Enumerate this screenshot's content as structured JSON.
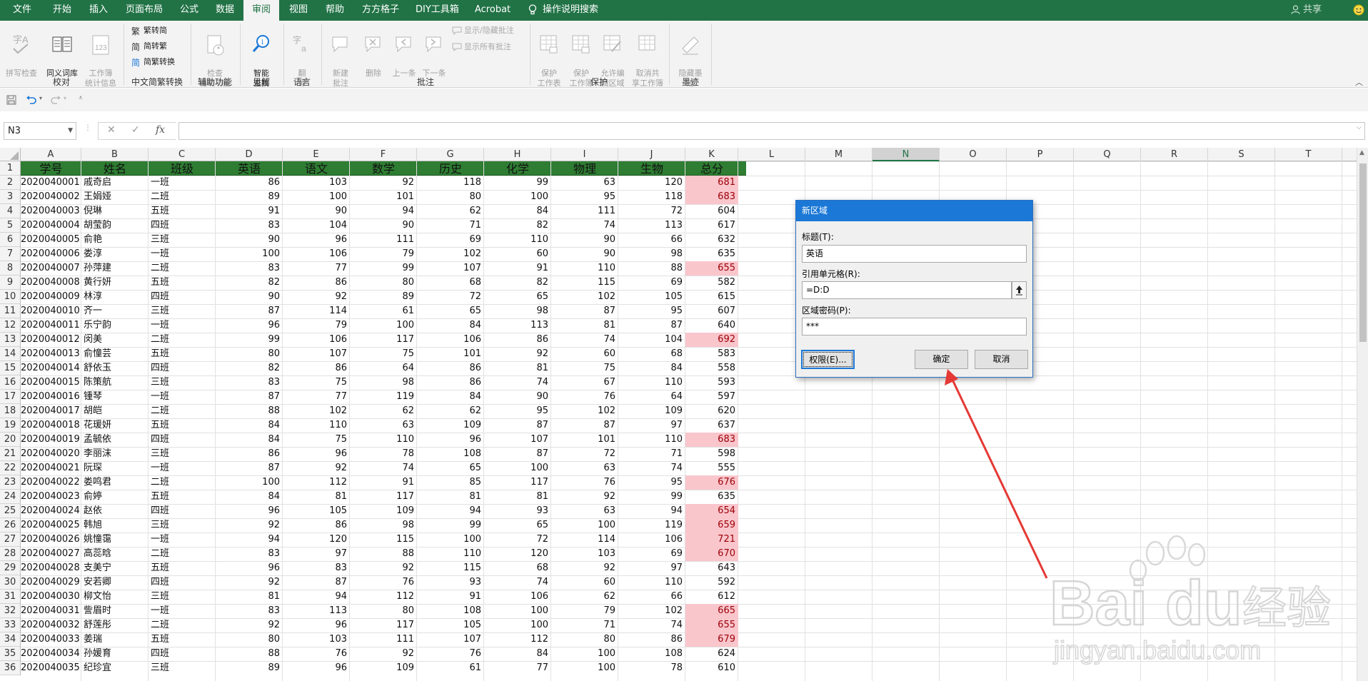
{
  "tabs": [
    {
      "label": "文件",
      "active": false
    },
    {
      "label": "开始",
      "active": false
    },
    {
      "label": "插入",
      "active": false
    },
    {
      "label": "页面布局",
      "active": false
    },
    {
      "label": "公式",
      "active": false
    },
    {
      "label": "数据",
      "active": false
    },
    {
      "label": "审阅",
      "active": true
    },
    {
      "label": "视图",
      "active": false
    },
    {
      "label": "帮助",
      "active": false
    },
    {
      "label": "方方格子",
      "active": false
    },
    {
      "label": "DIY工具箱",
      "active": false
    },
    {
      "label": "Acrobat",
      "active": false
    }
  ],
  "tell_me": "操作说明搜索",
  "share": "共享",
  "ribbon": {
    "groups": [
      "校对",
      "中文简繁转换",
      "辅助功能",
      "见解",
      "语言",
      "批注",
      "保护",
      "墨迹"
    ],
    "spell": "拼写检查",
    "thesaurus": "同义词库",
    "wb_stats": "工作簿\n统计信息",
    "trad_to_simp": "繁转简",
    "simp_to_trad": "简转繁",
    "conv": "简繁转换",
    "check_access": "检查\n辅助功能",
    "smart_lookup": "智能\n查找",
    "translate": "翻\n译",
    "new_comment": "新建\n批注",
    "delete": "删除",
    "prev": "上一条",
    "next": "下一条",
    "show_hide": "显示/隐藏批注",
    "show_all": "显示所有批注",
    "protect_sheet": "保护\n工作表",
    "protect_wb": "保护\n工作簿",
    "allow_edit": "允许编\n辑区域",
    "unshare": "取消共\n享工作簿",
    "hide_ink": "隐藏墨\n迹"
  },
  "namebox": "N3",
  "formula_value": "",
  "columns": [
    "A",
    "B",
    "C",
    "D",
    "E",
    "F",
    "G",
    "H",
    "I",
    "J",
    "K",
    "L",
    "M",
    "N",
    "O",
    "P",
    "Q",
    "R",
    "S",
    "T"
  ],
  "selected_col": "N",
  "headers": [
    "学号",
    "姓名",
    "班级",
    "英语",
    "语文",
    "数学",
    "历史",
    "化学",
    "物理",
    "生物",
    "总分"
  ],
  "rows": [
    [
      "2020040001",
      "戚奇启",
      "一班",
      "86",
      "103",
      "92",
      "118",
      "99",
      "63",
      "120",
      "681"
    ],
    [
      "2020040002",
      "王娟娅",
      "二班",
      "89",
      "100",
      "101",
      "80",
      "100",
      "95",
      "118",
      "683"
    ],
    [
      "2020040003",
      "倪琳",
      "五班",
      "91",
      "90",
      "94",
      "62",
      "84",
      "111",
      "72",
      "604"
    ],
    [
      "2020040004",
      "胡莹韵",
      "四班",
      "83",
      "104",
      "90",
      "71",
      "82",
      "74",
      "113",
      "617"
    ],
    [
      "2020040005",
      "俞艳",
      "三班",
      "90",
      "96",
      "111",
      "69",
      "110",
      "90",
      "66",
      "632"
    ],
    [
      "2020040006",
      "娄淳",
      "一班",
      "100",
      "106",
      "79",
      "102",
      "60",
      "90",
      "98",
      "635"
    ],
    [
      "2020040007",
      "孙萍建",
      "二班",
      "83",
      "77",
      "99",
      "107",
      "91",
      "110",
      "88",
      "655"
    ],
    [
      "2020040008",
      "黄行妍",
      "五班",
      "82",
      "86",
      "80",
      "68",
      "82",
      "115",
      "69",
      "582"
    ],
    [
      "2020040009",
      "林淳",
      "四班",
      "90",
      "92",
      "89",
      "72",
      "65",
      "102",
      "105",
      "615"
    ],
    [
      "2020040010",
      "齐一",
      "三班",
      "87",
      "114",
      "61",
      "65",
      "98",
      "87",
      "95",
      "607"
    ],
    [
      "2020040011",
      "乐宁韵",
      "一班",
      "96",
      "79",
      "100",
      "84",
      "113",
      "81",
      "87",
      "640"
    ],
    [
      "2020040012",
      "闵美",
      "二班",
      "99",
      "106",
      "117",
      "106",
      "86",
      "74",
      "104",
      "692"
    ],
    [
      "2020040013",
      "俞憧芸",
      "五班",
      "80",
      "107",
      "75",
      "101",
      "92",
      "60",
      "68",
      "583"
    ],
    [
      "2020040014",
      "舒依玉",
      "四班",
      "82",
      "86",
      "64",
      "86",
      "81",
      "75",
      "84",
      "558"
    ],
    [
      "2020040015",
      "陈策航",
      "三班",
      "83",
      "75",
      "98",
      "86",
      "74",
      "67",
      "110",
      "593"
    ],
    [
      "2020040016",
      "锺琴",
      "一班",
      "87",
      "77",
      "119",
      "84",
      "90",
      "76",
      "64",
      "597"
    ],
    [
      "2020040017",
      "胡皑",
      "二班",
      "88",
      "102",
      "62",
      "62",
      "95",
      "102",
      "109",
      "620"
    ],
    [
      "2020040018",
      "花瑗妍",
      "五班",
      "84",
      "110",
      "63",
      "109",
      "87",
      "87",
      "97",
      "637"
    ],
    [
      "2020040019",
      "孟毓依",
      "四班",
      "84",
      "75",
      "110",
      "96",
      "107",
      "101",
      "110",
      "683"
    ],
    [
      "2020040020",
      "李丽沫",
      "三班",
      "86",
      "96",
      "78",
      "108",
      "87",
      "72",
      "71",
      "598"
    ],
    [
      "2020040021",
      "阮琛",
      "一班",
      "87",
      "92",
      "74",
      "65",
      "100",
      "63",
      "74",
      "555"
    ],
    [
      "2020040022",
      "娄鸣君",
      "二班",
      "100",
      "112",
      "91",
      "85",
      "117",
      "76",
      "95",
      "676"
    ],
    [
      "2020040023",
      "俞婷",
      "五班",
      "84",
      "81",
      "117",
      "81",
      "81",
      "92",
      "99",
      "635"
    ],
    [
      "2020040024",
      "赵依",
      "四班",
      "96",
      "105",
      "109",
      "94",
      "93",
      "63",
      "94",
      "654"
    ],
    [
      "2020040025",
      "韩旭",
      "三班",
      "92",
      "86",
      "98",
      "99",
      "65",
      "100",
      "119",
      "659"
    ],
    [
      "2020040026",
      "姚憧霭",
      "一班",
      "94",
      "120",
      "115",
      "100",
      "72",
      "114",
      "106",
      "721"
    ],
    [
      "2020040027",
      "高蕊晗",
      "二班",
      "83",
      "97",
      "88",
      "110",
      "120",
      "103",
      "69",
      "670"
    ],
    [
      "2020040028",
      "支美宁",
      "五班",
      "96",
      "83",
      "92",
      "115",
      "68",
      "92",
      "97",
      "643"
    ],
    [
      "2020040029",
      "安若卿",
      "四班",
      "92",
      "87",
      "76",
      "93",
      "74",
      "60",
      "110",
      "592"
    ],
    [
      "2020040030",
      "柳文怡",
      "三班",
      "81",
      "94",
      "112",
      "91",
      "106",
      "62",
      "66",
      "612"
    ],
    [
      "2020040031",
      "訾眉时",
      "一班",
      "83",
      "113",
      "80",
      "108",
      "100",
      "79",
      "102",
      "665"
    ],
    [
      "2020040032",
      "舒莲彤",
      "二班",
      "92",
      "96",
      "117",
      "105",
      "100",
      "71",
      "74",
      "655"
    ],
    [
      "2020040033",
      "姜瑞",
      "五班",
      "80",
      "103",
      "111",
      "107",
      "112",
      "80",
      "86",
      "679"
    ],
    [
      "2020040034",
      "孙媛育",
      "四班",
      "88",
      "76",
      "92",
      "76",
      "84",
      "100",
      "108",
      "624"
    ],
    [
      "2020040035",
      "纪珍宜",
      "三班",
      "89",
      "96",
      "109",
      "61",
      "77",
      "100",
      "78",
      "610"
    ]
  ],
  "highlight_threshold": 650,
  "colors": {
    "excel_green": "#217346",
    "header_fill": "#2e7d32",
    "highlight_fill": "#f9c6cc",
    "highlight_text": "#9c0006",
    "dialog_title": "#1b78d6",
    "arrow": "#e53935"
  },
  "dialog": {
    "title": "新区域",
    "title_label": "标题(T):",
    "title_value": "英语",
    "ref_label": "引用单元格(R):",
    "ref_value": "=D:D",
    "pwd_label": "区域密码(P):",
    "pwd_value": "***",
    "perm_button": "权限(E)...",
    "ok_button": "确定",
    "cancel_button": "取消"
  },
  "watermark": {
    "brand": "Bai",
    "brand2": "du",
    "cn": "经验",
    "url": "jingyan.baidu.com"
  }
}
